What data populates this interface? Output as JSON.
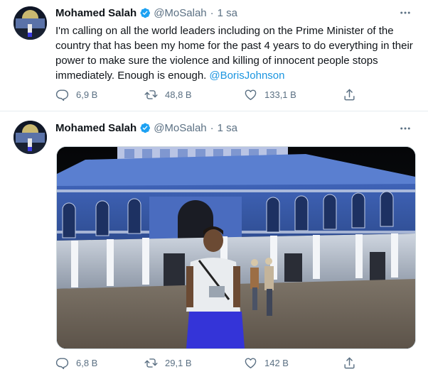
{
  "tweets": [
    {
      "author": {
        "name": "Mohamed Salah",
        "handle": "@MoSalah"
      },
      "separator": "·",
      "time": "1 sa",
      "text": "I'm calling on all the world leaders including on the Prime Minister of the country that has been my home for the past 4 years to do everything in their power to make sure the violence and killing of innocent people stops immediately. Enough is enough.",
      "mention": "@BorisJohnson",
      "stats": {
        "replies": "6,9 B",
        "retweets": "48,8 B",
        "likes": "133,1 B"
      }
    },
    {
      "author": {
        "name": "Mohamed Salah",
        "handle": "@MoSalah"
      },
      "separator": "·",
      "time": "1 sa",
      "media": {
        "subject": "man standing in front of a domed building at night"
      },
      "stats": {
        "replies": "6,8 B",
        "retweets": "29,1 B",
        "likes": "142 B"
      }
    }
  ],
  "colors": {
    "verified": "#1da1f2",
    "link": "#1b95e0",
    "muted": "#5b7083",
    "text": "#0f1419"
  },
  "icons": [
    "verified-badge-icon",
    "more-icon",
    "reply-icon",
    "retweet-icon",
    "like-icon",
    "share-icon"
  ]
}
